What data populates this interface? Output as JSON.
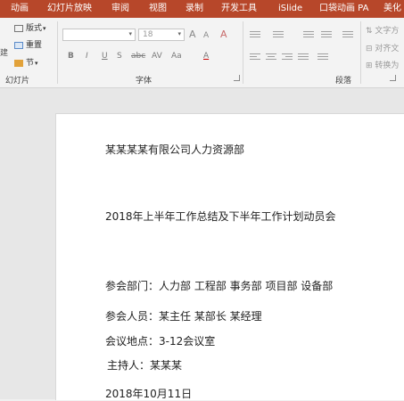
{
  "tabs": [
    "动画",
    "幻灯片放映",
    "审阅",
    "视图",
    "录制",
    "开发工具",
    "iSlide",
    "口袋动画 PA",
    "美化"
  ],
  "slides_group": {
    "layout_label": "版式",
    "reset_label": "重置",
    "section_label": "节",
    "group_label": "幻灯片",
    "cut_left_glyph": "建"
  },
  "font_group": {
    "font_name_value": "",
    "font_size_value": "18",
    "grow_label": "A",
    "shrink_label": "A",
    "clear_format_label": "A",
    "bold_label": "B",
    "italic_label": "I",
    "underline_label": "U",
    "shadow_label": "S",
    "strikethrough_label": "abc",
    "spacing_label": "AV",
    "case_label": "Aa",
    "color_label": "A",
    "group_label": "字体"
  },
  "paragraph_group": {
    "group_label": "段落",
    "text_direction_label": "文字方",
    "align_text_label": "对齐文",
    "convert_label": "转换为"
  },
  "document": {
    "lines": [
      "某某某某有限公司人力资源部",
      "2018年上半年工作总结及下半年工作计划动员会",
      "参会部门：人力部  工程部  事务部  项目部  设备部",
      "参会人员：某主任  某部长  某经理",
      "会议地点：3-12会议室",
      "主持人：某某某",
      "2018年10月11日"
    ]
  }
}
